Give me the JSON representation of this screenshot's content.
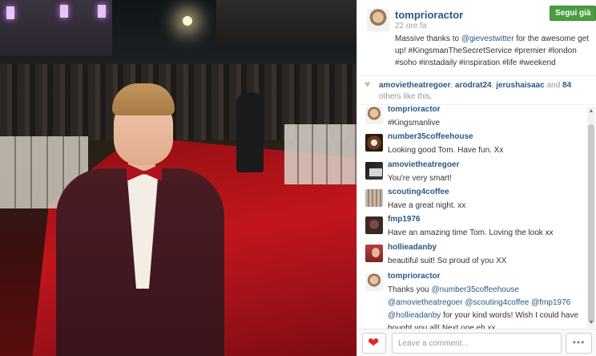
{
  "post": {
    "username": "tomprioractor",
    "time": "22 ore fa",
    "follow_label": "Segui già",
    "caption": {
      "before": "Massive thanks to ",
      "mention": "@gievestwitter",
      "after": " for the awesome get up! #KingsmanTheSecretService #premier #london #soho #instadaily #inspiration #life #weekend"
    }
  },
  "likes": {
    "users": [
      "amovietheatregoer",
      "arodrat24",
      "jerushaisaac"
    ],
    "and_text": " and ",
    "count": "84",
    "tail": "others like this."
  },
  "comments": [
    {
      "user": "tomprioractor",
      "avatar": "av-tom",
      "text": "#Kingsmanlive"
    },
    {
      "user": "number35coffeehouse",
      "avatar": "av-coffee",
      "text": "Looking good Tom. Have fun. Xx"
    },
    {
      "user": "amovietheatregoer",
      "avatar": "av-amovie",
      "text": "You're very smart!"
    },
    {
      "user": "scouting4coffee",
      "avatar": "av-scout",
      "text": "Have a great night. xx"
    },
    {
      "user": "fmp1976",
      "avatar": "av-fmp",
      "text": "Have an amazing time Tom. Loving the look xx"
    },
    {
      "user": "hollieadanby",
      "avatar": "av-hollie",
      "text": "beautiful suit! So proud of you XX"
    }
  ],
  "reply": {
    "user": "tomprioractor",
    "prefix": "Thanks you ",
    "m1": "@number35coffeehouse",
    "m2": "@amovietheatregoer",
    "m3": "@scouting4coffee",
    "m4": "@fmp1976",
    "m5": "@hollieadanby",
    "suffix": " for your kind words! Wish I could have bought you all! Next one eh xx"
  },
  "footer": {
    "comment_placeholder": "Leave a comment...",
    "more_label": "•••"
  },
  "colors": {
    "follow_green": "#4b9d3f",
    "link_blue": "#2a5885",
    "heart_red": "#e02a2a"
  }
}
